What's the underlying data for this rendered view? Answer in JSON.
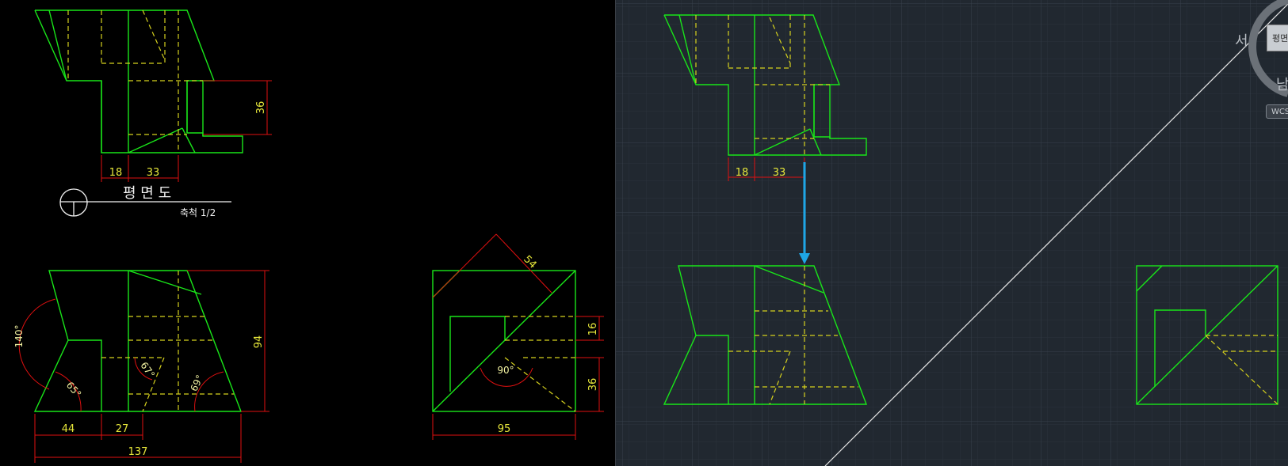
{
  "left_drawing": {
    "plan_dims": {
      "d18": "18",
      "d33": "33",
      "d36": "36"
    },
    "plan_title": "평 면 도",
    "plan_scale": "축척 1/2",
    "front_dims": {
      "d44": "44",
      "d27": "27",
      "d137": "137",
      "d94": "94",
      "a140": "140°",
      "a65": "65°",
      "a67": "67°",
      "a69": "69°"
    },
    "side_dims": {
      "d54": "54",
      "d16": "16",
      "d36": "36",
      "d95": "95",
      "a90": "90°"
    }
  },
  "right_viewport": {
    "plan_dims": {
      "d18": "18",
      "d33": "33"
    },
    "viewcube": {
      "face_label": "평면",
      "west_label": "서",
      "south_label": "남",
      "wcs_label": "WCS"
    }
  },
  "colors": {
    "object_lines": "#19e619",
    "hidden_lines": "#d6d21e",
    "dimension_lines": "#e01010",
    "dim_text": "#e6e63a",
    "arrow": "#1ea6e6",
    "viewport_bg": "#212830"
  }
}
